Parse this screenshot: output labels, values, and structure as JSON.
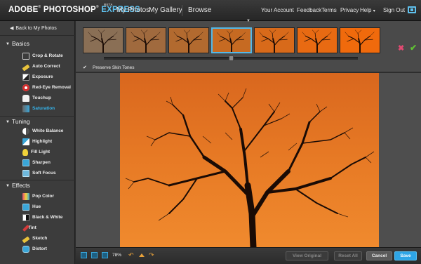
{
  "header": {
    "brand": {
      "adobe": "ADOBE",
      "photoshop": "PHOTOSHOP",
      "express": "EXPRESS",
      "beta": "BETA",
      "reg": "®"
    },
    "nav": [
      "My Photos",
      "My Gallery",
      "Browse"
    ],
    "utility": [
      "Your Account",
      "Feedback",
      "Terms",
      "Privacy",
      "Help",
      "Sign Out"
    ],
    "help_caret": "▾"
  },
  "sidebar": {
    "back_label": "Back to My Photos",
    "sections": [
      {
        "title": "Basics",
        "items": [
          {
            "label": "Crop & Rotate",
            "icon": "crop-icon"
          },
          {
            "label": "Auto Correct",
            "icon": "pencil-icon"
          },
          {
            "label": "Exposure",
            "icon": "exposure-icon"
          },
          {
            "label": "Red-Eye Removal",
            "icon": "red-eye-icon"
          },
          {
            "label": "Touchup",
            "icon": "hand-icon"
          },
          {
            "label": "Saturation",
            "icon": "saturation-icon",
            "active": true
          }
        ]
      },
      {
        "title": "Tuning",
        "items": [
          {
            "label": "White Balance",
            "icon": "white-balance-icon"
          },
          {
            "label": "Highlight",
            "icon": "highlight-icon"
          },
          {
            "label": "Fill Light",
            "icon": "bulb-icon"
          },
          {
            "label": "Sharpen",
            "icon": "sharpen-icon"
          },
          {
            "label": "Soft Focus",
            "icon": "soft-focus-icon"
          }
        ]
      },
      {
        "title": "Effects",
        "items": [
          {
            "label": "Pop Color",
            "icon": "pop-color-icon"
          },
          {
            "label": "Hue",
            "icon": "hue-icon"
          },
          {
            "label": "Black & White",
            "icon": "black-white-icon"
          },
          {
            "label": "Tint",
            "icon": "tint-icon"
          },
          {
            "label": "Sketch",
            "icon": "sketch-icon"
          },
          {
            "label": "Distort",
            "icon": "distort-icon"
          }
        ]
      }
    ]
  },
  "filmstrip": {
    "selected_index": 3,
    "thumb_colors": [
      "#8a6f55",
      "#a06a3e",
      "#b26a2f",
      "#c66a22",
      "#d86a1a",
      "#e86a12",
      "#f06a0c"
    ],
    "slider_level": 0.5
  },
  "options": {
    "preserve_skin_tones": "Preserve Skin Tones",
    "checked": true
  },
  "footer": {
    "zoom": "78%",
    "buttons": {
      "view_original": "View Original",
      "reset_all": "Reset All",
      "cancel": "Cancel",
      "save": "Save"
    }
  },
  "colors": {
    "accent": "#2ea5e6",
    "express": "#5fc1ee",
    "reject": "#e24a72",
    "accept": "#60c234",
    "undo": "#e8a23b"
  }
}
